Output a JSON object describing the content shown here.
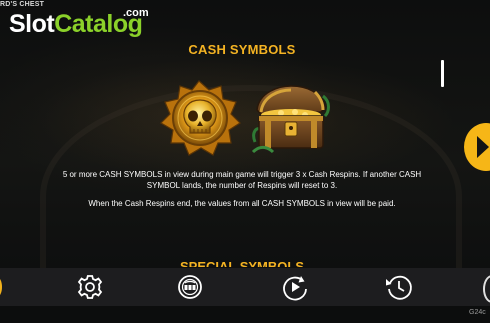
{
  "game": {
    "title_fragment": "RD'S CHEST"
  },
  "logo": {
    "slot": "Slot",
    "catalog": "Catalog",
    "com": ".com"
  },
  "section": {
    "title": "CASH SYMBOLS",
    "paragraph_1": "5 or more CASH SYMBOLS in view during main game will trigger 3 x Cash Respins. If another CASH SYMBOL lands, the number of Respins will reset to 3.",
    "paragraph_2": "When the Cash Respins end, the values from all CASH SYMBOLS in view will be paid.",
    "next_title": "SPECIAL SYMBOLS"
  },
  "symbols": [
    {
      "icon": "gold-skull-coin-icon"
    },
    {
      "icon": "treasure-chest-icon"
    }
  ],
  "toolbar": {
    "items": [
      {
        "icon": "settings-gear-icon"
      },
      {
        "icon": "paytable-icon"
      },
      {
        "icon": "autoplay-icon"
      },
      {
        "icon": "history-icon"
      }
    ]
  },
  "watermark": "G24c",
  "colors": {
    "accent": "#f4b323",
    "logo_green": "#8bd12a",
    "bar": "#1d1d1f"
  }
}
